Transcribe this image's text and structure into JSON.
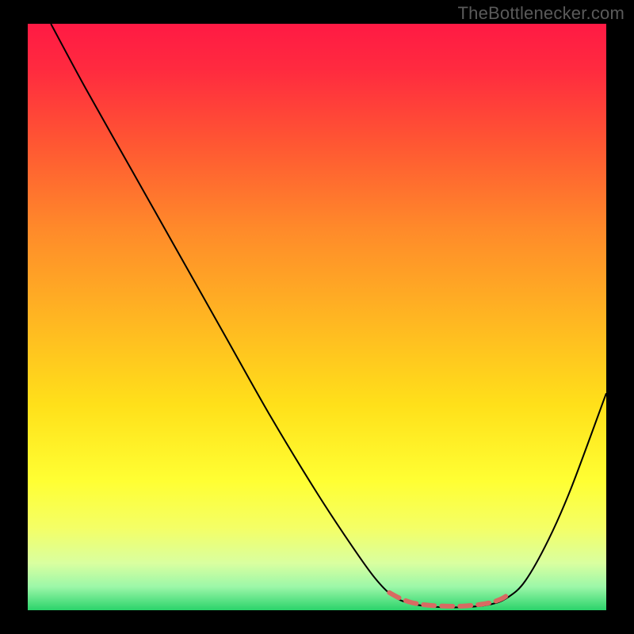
{
  "watermark": "TheBottlenecker.com",
  "chart_data": {
    "type": "line",
    "title": "",
    "xlabel": "",
    "ylabel": "",
    "xlim": [
      0,
      100
    ],
    "ylim": [
      0,
      100
    ],
    "background_gradient": {
      "stops": [
        {
          "offset": 0.0,
          "color": "#ff1a44"
        },
        {
          "offset": 0.08,
          "color": "#ff2b3f"
        },
        {
          "offset": 0.2,
          "color": "#ff5533"
        },
        {
          "offset": 0.35,
          "color": "#ff8a2a"
        },
        {
          "offset": 0.5,
          "color": "#ffb522"
        },
        {
          "offset": 0.65,
          "color": "#ffe01a"
        },
        {
          "offset": 0.78,
          "color": "#ffff33"
        },
        {
          "offset": 0.86,
          "color": "#f4ff66"
        },
        {
          "offset": 0.92,
          "color": "#d9ffa0"
        },
        {
          "offset": 0.96,
          "color": "#9cf7a8"
        },
        {
          "offset": 1.0,
          "color": "#2bd36b"
        }
      ]
    },
    "series": [
      {
        "name": "bottleneck-curve",
        "color": "#000000",
        "width": 2,
        "points": [
          {
            "x": 4.0,
            "y": 100.0
          },
          {
            "x": 10.0,
            "y": 89.0
          },
          {
            "x": 18.0,
            "y": 75.0
          },
          {
            "x": 26.0,
            "y": 61.0
          },
          {
            "x": 34.0,
            "y": 47.0
          },
          {
            "x": 42.0,
            "y": 33.0
          },
          {
            "x": 50.0,
            "y": 20.0
          },
          {
            "x": 56.0,
            "y": 11.0
          },
          {
            "x": 60.0,
            "y": 5.5
          },
          {
            "x": 63.0,
            "y": 2.5
          },
          {
            "x": 66.0,
            "y": 1.2
          },
          {
            "x": 70.0,
            "y": 0.6
          },
          {
            "x": 75.0,
            "y": 0.5
          },
          {
            "x": 80.0,
            "y": 1.0
          },
          {
            "x": 83.0,
            "y": 2.2
          },
          {
            "x": 86.0,
            "y": 5.0
          },
          {
            "x": 90.0,
            "y": 12.0
          },
          {
            "x": 94.0,
            "y": 21.0
          },
          {
            "x": 100.0,
            "y": 37.0
          }
        ]
      },
      {
        "name": "minimum-highlight",
        "color": "#d86a62",
        "width": 6,
        "points": [
          {
            "x": 62.5,
            "y": 3.0
          },
          {
            "x": 64.0,
            "y": 2.2
          },
          {
            "x": 66.0,
            "y": 1.4
          },
          {
            "x": 68.0,
            "y": 1.0
          },
          {
            "x": 70.0,
            "y": 0.8
          },
          {
            "x": 72.5,
            "y": 0.7
          },
          {
            "x": 75.0,
            "y": 0.7
          },
          {
            "x": 77.5,
            "y": 0.9
          },
          {
            "x": 80.0,
            "y": 1.3
          },
          {
            "x": 82.0,
            "y": 2.0
          },
          {
            "x": 83.5,
            "y": 3.0
          }
        ]
      }
    ]
  }
}
